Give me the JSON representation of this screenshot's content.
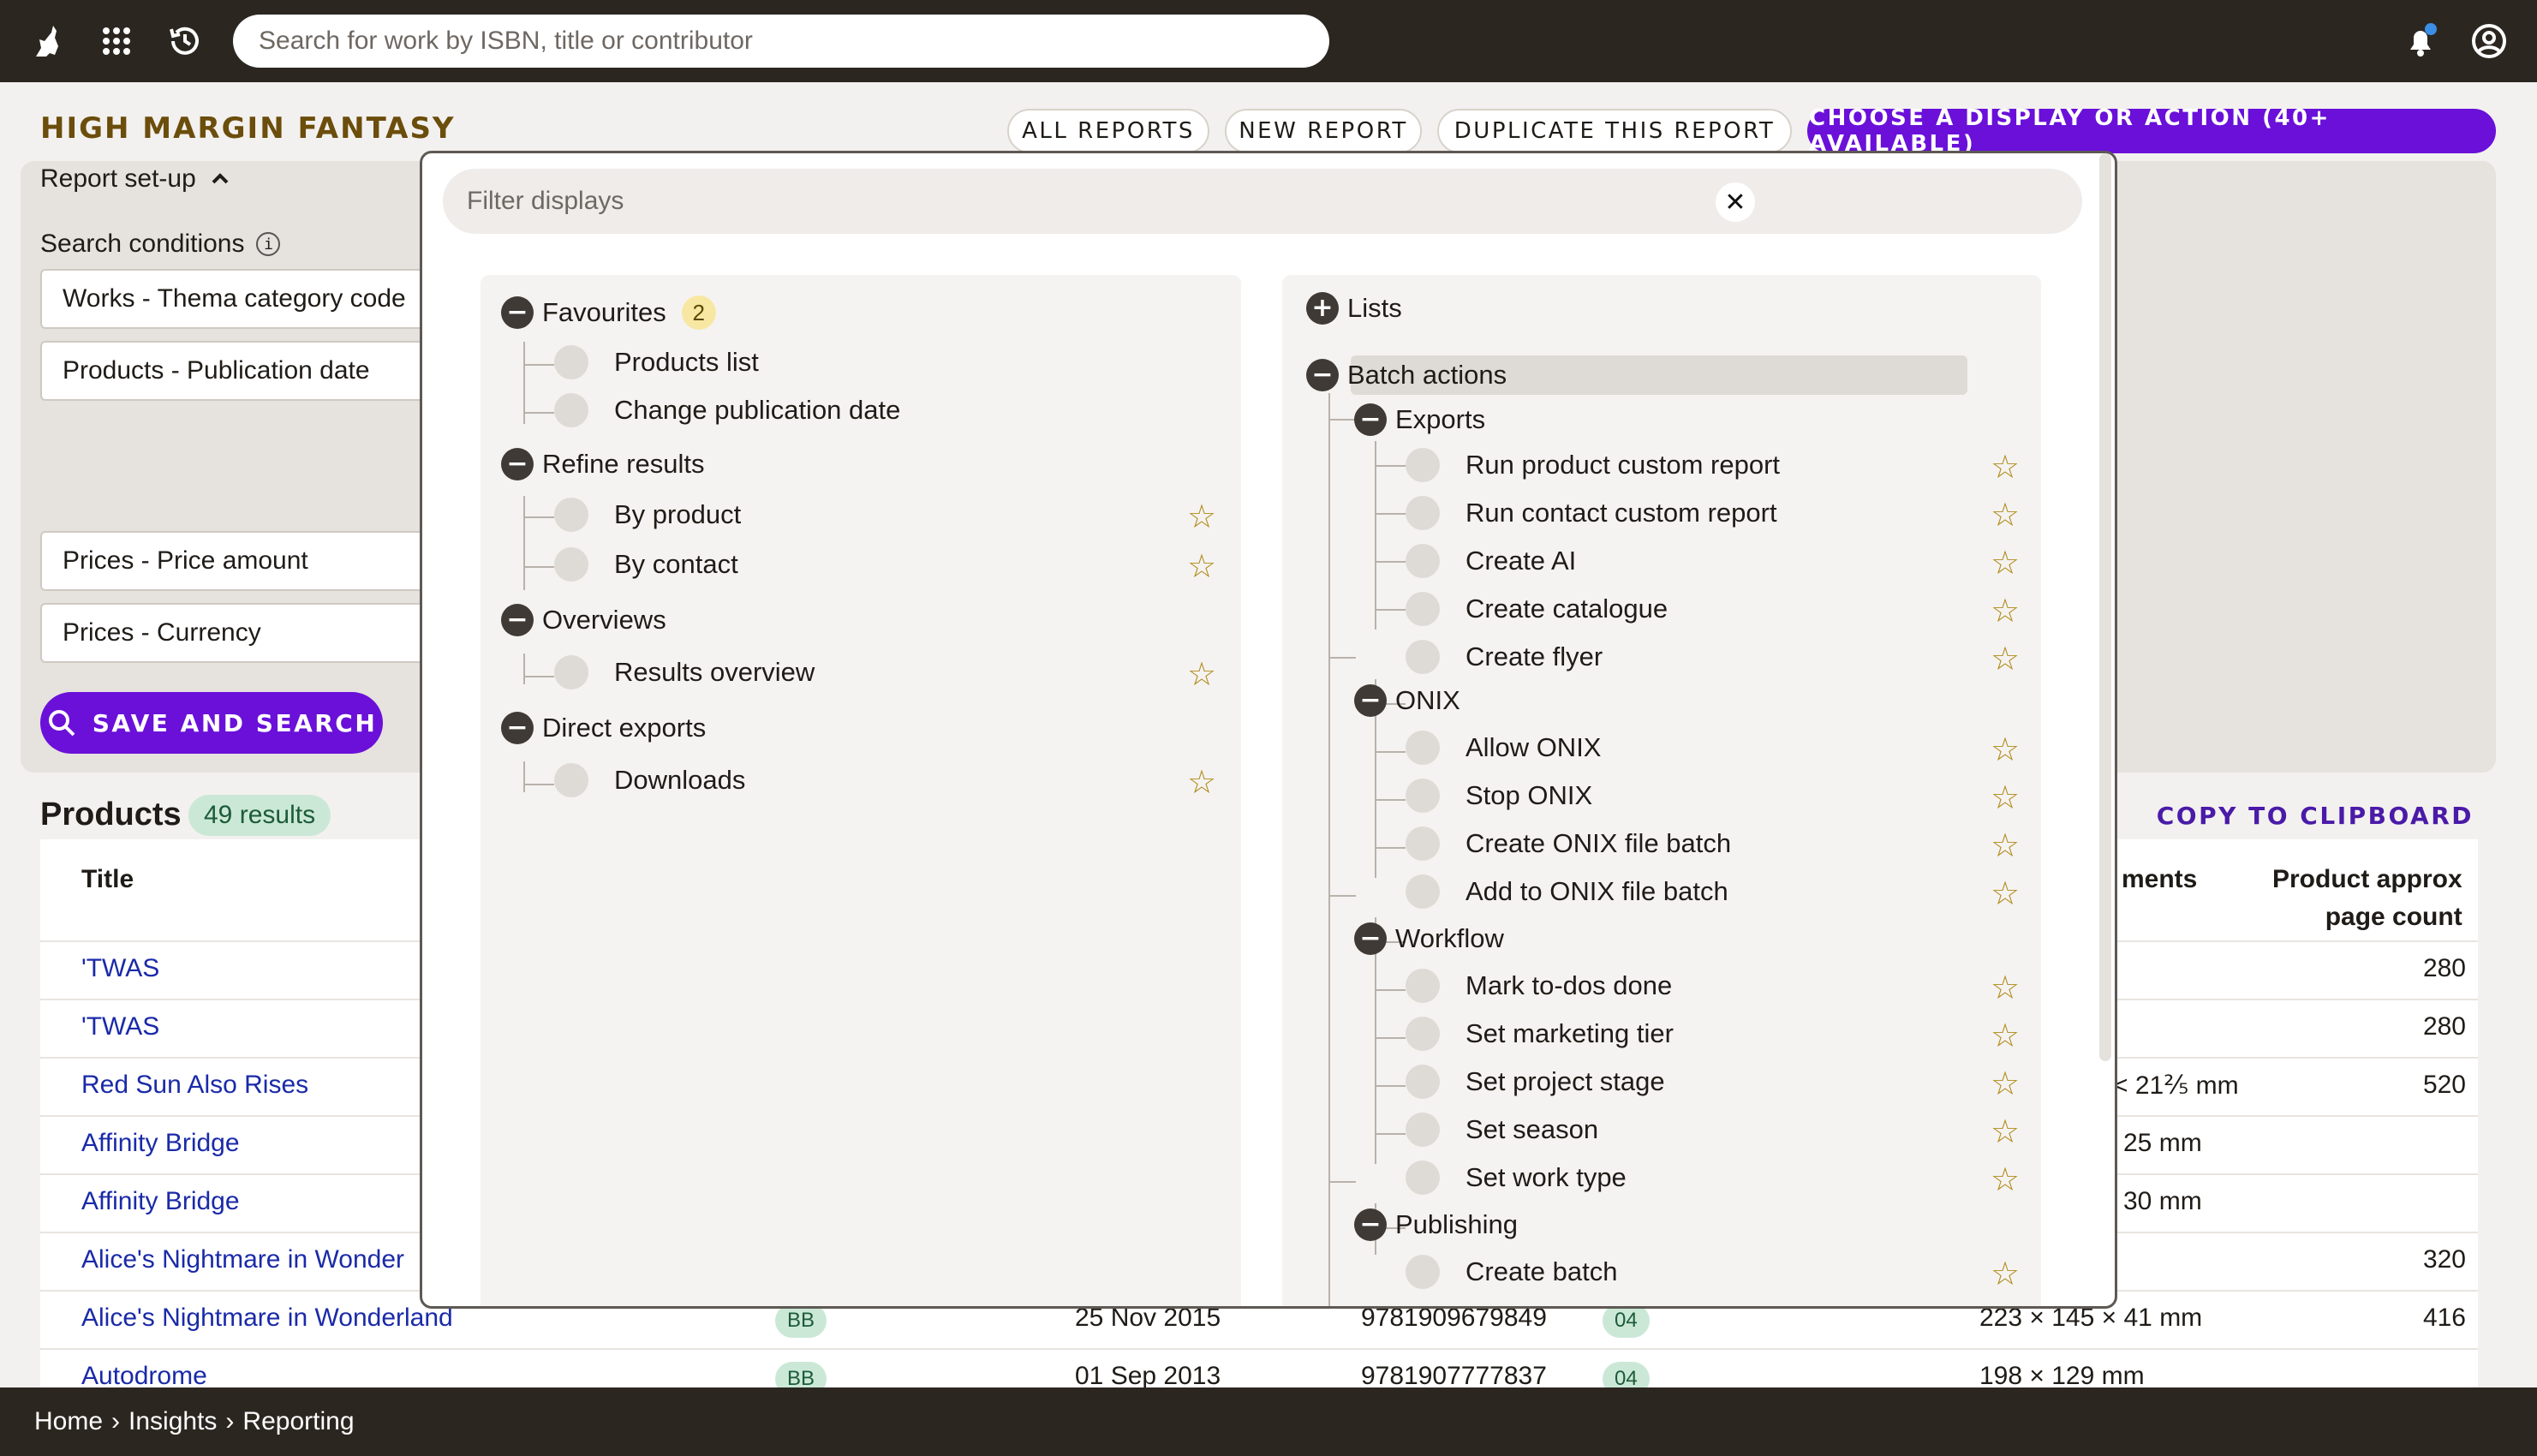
{
  "topbar": {
    "logo_icon": "cat-logo-icon",
    "apps_icon": "apps-grid-icon",
    "history_icon": "history-icon",
    "search_placeholder": "Search for work by ISBN, title or contributor",
    "notifications_icon": "bell-icon",
    "account_icon": "user-icon"
  },
  "report": {
    "title": "HIGH MARGIN FANTASY",
    "buttons": {
      "all_reports": "ALL REPORTS",
      "new_report": "NEW REPORT",
      "duplicate": "DUPLICATE THIS REPORT",
      "choose_display": "CHOOSE A DISPLAY OR ACTION (40+ AVAILABLE)"
    },
    "setup_label": "Report set-up",
    "search_conditions_label": "Search conditions",
    "info_badge": "i",
    "conditions": [
      "Works - Thema category code",
      "Products - Publication date",
      "Prices - Price amount",
      "Prices - Currency"
    ],
    "save_label": "SAVE AND SEARCH"
  },
  "products": {
    "title": "Products",
    "results": "49 results",
    "copy_label": "COPY TO CLIPBOARD",
    "headers": {
      "title": "Title",
      "measurements": "ments",
      "page_count_1": "Product approx",
      "page_count_2": "page count"
    },
    "rows": [
      {
        "title": "'TWAS",
        "measure": "",
        "pages": "280"
      },
      {
        "title": "'TWAS",
        "measure": "",
        "pages": "280"
      },
      {
        "title": "Red Sun Also Rises",
        "measure": "< 21⅖ mm",
        "pages": "520"
      },
      {
        "title": "Affinity Bridge",
        "measure": "25 mm",
        "pages": ""
      },
      {
        "title": "Affinity Bridge",
        "measure": "30 mm",
        "pages": ""
      },
      {
        "title": "Alice's Nightmare in Wonder",
        "measure": "",
        "pages": "320"
      },
      {
        "title": "Alice's Nightmare in Wonderland",
        "format": "BB",
        "date": "25 Nov 2015",
        "isbn": "9781909679849",
        "code": "04",
        "measure": "223 × 145 × 41 mm",
        "pages": "416"
      },
      {
        "title": "Autodrome",
        "format": "BB",
        "date": "01 Sep 2013",
        "isbn": "9781907777837",
        "code": "04",
        "measure": "198 × 129 mm",
        "pages": ""
      }
    ]
  },
  "breadcrumb": [
    "Home",
    "Insights",
    "Reporting"
  ],
  "modal": {
    "filter_placeholder": "Filter displays",
    "clear_icon": "close-icon",
    "left": {
      "favourites": {
        "label": "Favourites",
        "count": "2",
        "items": [
          "Products list",
          "Change publication date"
        ]
      },
      "refine": {
        "label": "Refine results",
        "items": [
          "By product",
          "By contact"
        ]
      },
      "overviews": {
        "label": "Overviews",
        "items": [
          "Results overview"
        ]
      },
      "direct_exports": {
        "label": "Direct exports",
        "items": [
          "Downloads"
        ]
      }
    },
    "right": {
      "lists": {
        "label": "Lists"
      },
      "batch": {
        "label": "Batch actions"
      },
      "exports": {
        "label": "Exports",
        "items": [
          "Run product custom report",
          "Run contact custom report",
          "Create AI",
          "Create catalogue",
          "Create flyer"
        ]
      },
      "onix": {
        "label": "ONIX",
        "items": [
          "Allow ONIX",
          "Stop ONIX",
          "Create ONIX file batch",
          "Add to ONIX file batch"
        ]
      },
      "workflow": {
        "label": "Workflow",
        "items": [
          "Mark to-dos done",
          "Set marketing tier",
          "Set project stage",
          "Set season",
          "Set work type"
        ]
      },
      "publishing": {
        "label": "Publishing",
        "items": [
          "Create batch"
        ]
      }
    }
  },
  "colors": {
    "accent_purple": "#6a10d9",
    "title_brown": "#6b4d0c",
    "star_gold": "#b08a1a",
    "badge_green": "#cbe8d6",
    "badge_yellow": "#f8e7a3",
    "dark_bar": "#2c2621"
  }
}
